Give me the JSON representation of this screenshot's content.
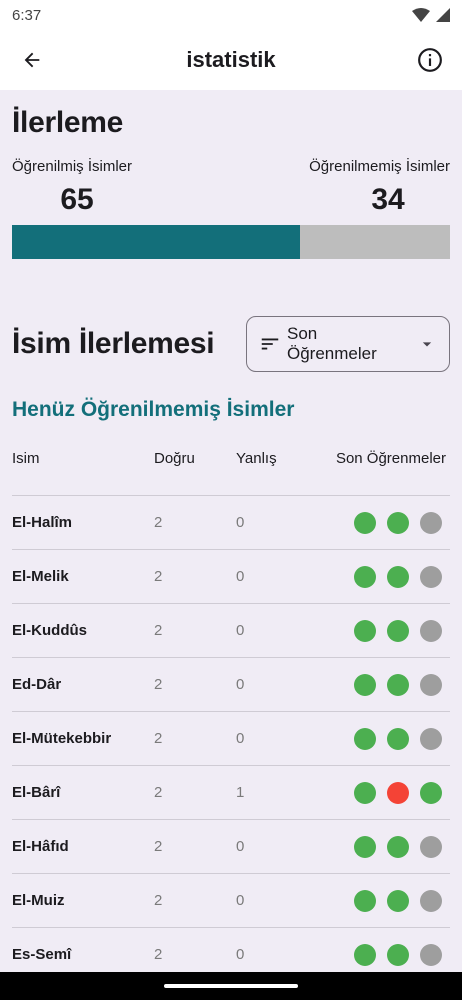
{
  "status_bar": {
    "time": "6:37"
  },
  "app_bar": {
    "title": "istatistik"
  },
  "progress": {
    "title": "İlerleme",
    "learned_label": "Öğrenilmiş İsimler",
    "unlearned_label": "Öğrenilmemiş İsimler",
    "learned_count": "65",
    "unlearned_count": "34",
    "learned_fraction": 0.6566,
    "fill_color": "#136f7a",
    "track_color": "#bdbdbd"
  },
  "name_progress": {
    "title": "İsim İlerlemesi",
    "sort_label": "Son Öğrenmeler",
    "subsection_title": "Henüz Öğrenilmemiş İsimler",
    "columns": {
      "name": "Isim",
      "correct": "Doğru",
      "wrong": "Yanlış",
      "recent": "Son Öğrenmeler"
    },
    "colors": {
      "correct": "#4caf50",
      "wrong": "#f44336",
      "none": "#9e9e9e"
    },
    "rows": [
      {
        "name": "El-Halîm",
        "correct": "2",
        "wrong": "0",
        "recent": [
          "correct",
          "correct",
          "none"
        ]
      },
      {
        "name": "El-Melik",
        "correct": "2",
        "wrong": "0",
        "recent": [
          "correct",
          "correct",
          "none"
        ]
      },
      {
        "name": "El-Kuddûs",
        "correct": "2",
        "wrong": "0",
        "recent": [
          "correct",
          "correct",
          "none"
        ]
      },
      {
        "name": "Ed-Dâr",
        "correct": "2",
        "wrong": "0",
        "recent": [
          "correct",
          "correct",
          "none"
        ]
      },
      {
        "name": "El-Mütekebbir",
        "correct": "2",
        "wrong": "0",
        "recent": [
          "correct",
          "correct",
          "none"
        ]
      },
      {
        "name": "El-Bârî",
        "correct": "2",
        "wrong": "1",
        "recent": [
          "correct",
          "wrong",
          "correct"
        ]
      },
      {
        "name": "El-Hâfıd",
        "correct": "2",
        "wrong": "0",
        "recent": [
          "correct",
          "correct",
          "none"
        ]
      },
      {
        "name": "El-Muiz",
        "correct": "2",
        "wrong": "0",
        "recent": [
          "correct",
          "correct",
          "none"
        ]
      },
      {
        "name": "Es-Semî",
        "correct": "2",
        "wrong": "0",
        "recent": [
          "correct",
          "correct",
          "none"
        ]
      }
    ]
  }
}
